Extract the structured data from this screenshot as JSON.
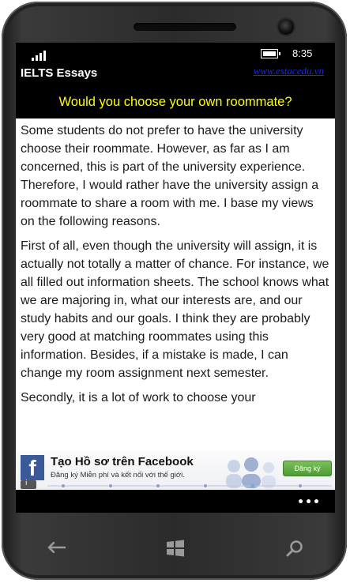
{
  "status_bar": {
    "time": "8:35"
  },
  "app_bar": {
    "title": "IELTS Essays",
    "link": "www.estacedu.vn"
  },
  "essay": {
    "title": "Would you choose  your own roommate?",
    "paragraphs": [
      "Some students do not prefer to have the university choose their roommate. However, as far as I am concerned, this is part of the university experience. Therefore, I would rather have the university assign a roommate to share a room with me. I base my views on the following reasons.",
      "First of all, even though the university will assign, it is actually not totally a matter of chance. For instance, we all filled out information sheets. The school knows what we are majoring in, what our interests are, and our study habits and our goals. I think they are probably very good at matching roommates using this information. Besides, if a mistake is made, I can change my room assignment next semester.",
      "Secondly, it is a lot of work to choose your"
    ]
  },
  "ad": {
    "logo_letter": "f",
    "title": "Tạo Hồ sơ trên Facebook",
    "subtitle": "Đăng ký Miễn phí và kết nối với thế giới.",
    "button": "Đăng ký"
  },
  "app_bar_bottom": {
    "more": "•••"
  },
  "colors": {
    "title_yellow": "#ffff00",
    "link_blue": "#1e2bd6",
    "facebook_blue": "#3b5998",
    "ad_button_green": "#4e9b35"
  },
  "icons": [
    "signal-icon",
    "battery-icon",
    "back-icon",
    "windows-icon",
    "search-icon"
  ]
}
